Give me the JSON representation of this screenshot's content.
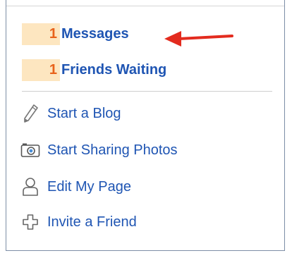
{
  "notifications": [
    {
      "count": "1",
      "label": "Messages"
    },
    {
      "count": "1",
      "label": "Friends Waiting"
    }
  ],
  "actions": [
    {
      "label": "Start a Blog",
      "icon": "pencil-icon"
    },
    {
      "label": "Start Sharing Photos",
      "icon": "camera-icon"
    },
    {
      "label": "Edit My Page",
      "icon": "person-icon"
    },
    {
      "label": "Invite a Friend",
      "icon": "plus-icon"
    }
  ],
  "colors": {
    "link": "#1f55b3",
    "count_text": "#e8621a",
    "count_bg": "#fde6c0",
    "arrow": "#e32b1e",
    "border": "#7d8ea6"
  }
}
